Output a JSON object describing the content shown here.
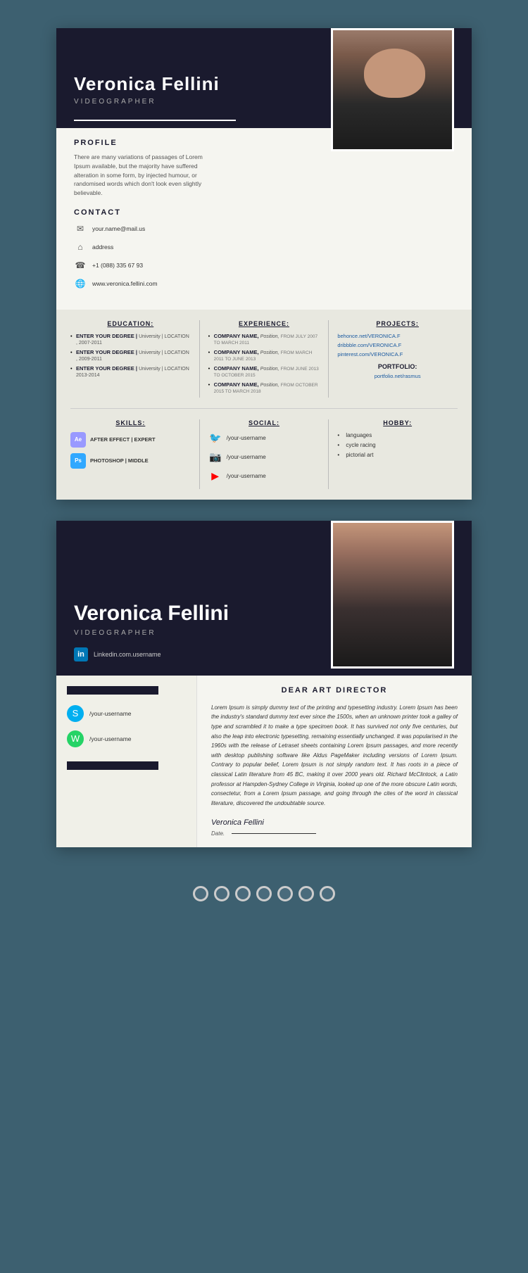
{
  "background": "#3d6070",
  "card1": {
    "header": {
      "name": "Veronica Fellini",
      "title": "VIDEOGRAPHER"
    },
    "profile": {
      "sectionTitle": "PROFILE",
      "text": "There are many variations of passages of Lorem Ipsum available, but the majority have suffered alteration in some form, by injected humour, or randomised words which don't look even slightly believable."
    },
    "contact": {
      "sectionTitle": "CONTACT",
      "email": "your.name@mail.us",
      "address": "address",
      "phone": "+1 (088) 335 67 93",
      "website": "www.veronica.fellini.com"
    },
    "education": {
      "title": "EDUCATION:",
      "items": [
        {
          "degree": "ENTER YOUR DEGREE |",
          "detail": "University | LOCATION , 2007-2011"
        },
        {
          "degree": "ENTER YOUR DEGREE |",
          "detail": "University | LOCATION , 2009-2011"
        },
        {
          "degree": "ENTER YOUR DEGREE |",
          "detail": "University | LOCATION 2013-2014"
        }
      ]
    },
    "experience": {
      "title": "EXPERIENCE:",
      "items": [
        {
          "company": "COMPANY NAME,",
          "position": "Position,",
          "dates": "FROM JULY 2007 TO MARCH 2011"
        },
        {
          "company": "COMPANY NAME,",
          "position": "Position,",
          "dates": "FROM MARCH 2011 TO JUNE 2013"
        },
        {
          "company": "COMPANY NAME,",
          "position": "Position,",
          "dates": "FROM JUNE 2013 TO OCTOBER 2015"
        },
        {
          "company": "COMPANY NAME,",
          "position": "Position,",
          "dates": "FROM OCTOBER 2015 TO MARCH 2018"
        }
      ]
    },
    "projects": {
      "title": "PROJECTS:",
      "links": [
        "behonce.net/VERONICA.F",
        "dribbble.com/VERONICA.F",
        "pinterest.com/VERONICA.F"
      ],
      "portfolioTitle": "PORTFOLIO:",
      "portfolioLink": "portfolio.net/rasmus"
    },
    "skills": {
      "title": "SKILLS:",
      "items": [
        {
          "name": "AFTER EFFECT",
          "level": "EXPERT",
          "badge": "Ae",
          "type": "ae"
        },
        {
          "name": "PHOTOSHOP",
          "level": "MIDDLE",
          "badge": "Ps",
          "type": "ps"
        }
      ]
    },
    "social": {
      "title": "SOCIAL:",
      "items": [
        {
          "platform": "twitter",
          "username": "/your-username",
          "icon": "🐦"
        },
        {
          "platform": "instagram",
          "username": "/your-username",
          "icon": "📷"
        },
        {
          "platform": "youtube",
          "username": "/your-username",
          "icon": "▶"
        }
      ]
    },
    "hobby": {
      "title": "HOBBY:",
      "items": [
        "languages",
        "cycle racing",
        "pictorial art"
      ]
    }
  },
  "card2": {
    "header": {
      "name": "Veronica Fellini",
      "title": "VIDEOGRAPHER",
      "linkedin": "Linkedin.com.username"
    },
    "letter": {
      "dearTitle": "DEAR ART DIRECTOR",
      "text": "Lorem Ipsum is simply dummy text of the printing and typesetting industry. Lorem Ipsum has been the industry's standard dummy text ever since the 1500s, when an unknown printer took a galley of type and scrambled it to make a type specimen book. It has survived not only five centuries, but also the leap into electronic typesetting, remaining essentially unchanged. It was popularised in the 1960s with the release of Letraset sheets containing Lorem Ipsum passages, and more recently with desktop publishing software like Aldus PageMaker including versions of Lorem Ipsum. Contrary to popular belief, Lorem Ipsum is not simply random text. It has roots in a piece of classical Latin literature from 45 BC, making it over 2000 years old. Richard McClintock, a Latin professor at Hampden-Sydney College in Virginia, looked up one of the more obscure Latin words, consectetur, from a Lorem Ipsum passage, and going through the cites of the word in classical literature, discovered the undoubtable source."
    },
    "social": {
      "items": [
        {
          "platform": "skype",
          "username": "/your-username",
          "icon": "S"
        },
        {
          "platform": "whatsapp",
          "username": "/your-username",
          "icon": "W"
        }
      ]
    },
    "signature": {
      "name": "Veronica Fellini",
      "dateLabel": "Date."
    }
  },
  "rings": {
    "count": 7
  }
}
